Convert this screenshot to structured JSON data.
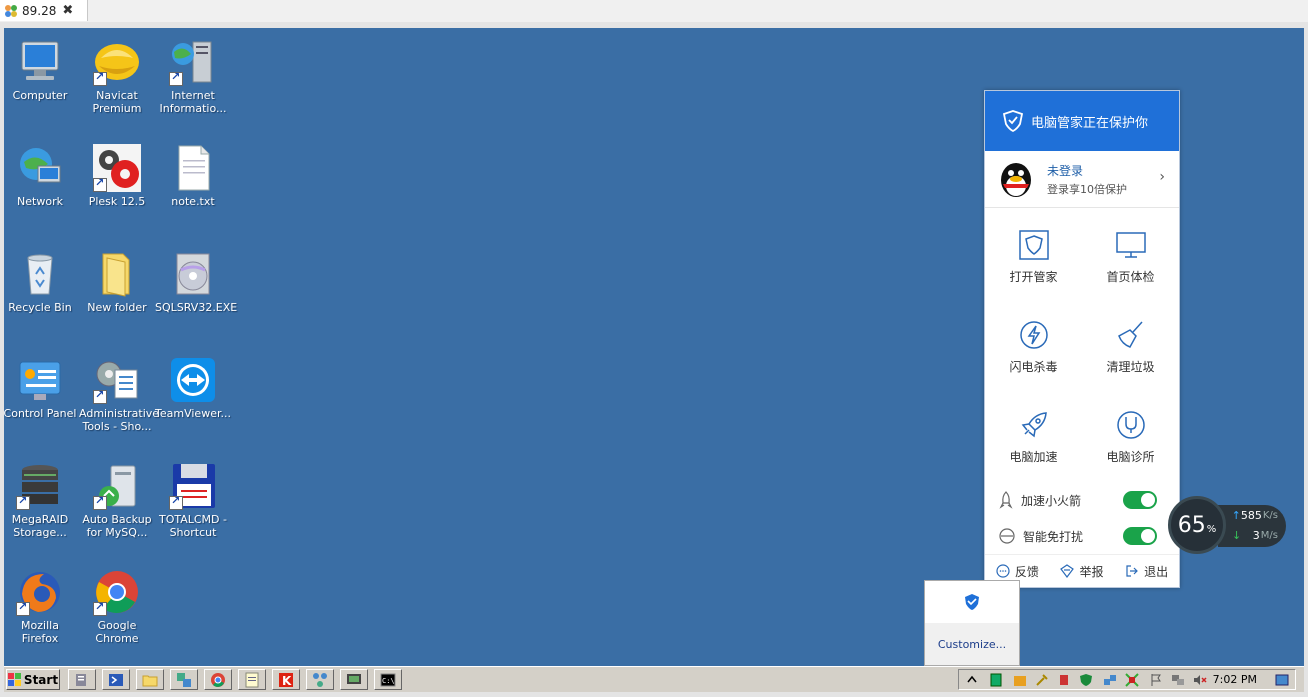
{
  "window": {
    "tab_title": "89.28"
  },
  "desktop_icons": [
    {
      "label": "Computer"
    },
    {
      "label": "Navicat Premium"
    },
    {
      "label": "Internet Informatio..."
    },
    {
      "label": "Network"
    },
    {
      "label": "Plesk 12.5"
    },
    {
      "label": "note.txt"
    },
    {
      "label": "Recycle Bin"
    },
    {
      "label": "New folder"
    },
    {
      "label": "SQLSRV32.EXE"
    },
    {
      "label": "Control Panel"
    },
    {
      "label": "Administrative Tools - Sho..."
    },
    {
      "label": "TeamViewer..."
    },
    {
      "label": "MegaRAID Storage..."
    },
    {
      "label": "Auto Backup for MySQ..."
    },
    {
      "label": "TOTALCMD - Shortcut"
    },
    {
      "label": "Mozilla Firefox"
    },
    {
      "label": "Google Chrome"
    }
  ],
  "security_panel": {
    "header": "电脑管家正在保护你",
    "user_name": "未登录",
    "user_sub": "登录享10倍保护",
    "grid": [
      {
        "label": "打开管家",
        "icon": "shield-icon"
      },
      {
        "label": "首页体检",
        "icon": "monitor-icon"
      },
      {
        "label": "闪电杀毒",
        "icon": "lightning-icon"
      },
      {
        "label": "清理垃圾",
        "icon": "broom-icon"
      },
      {
        "label": "电脑加速",
        "icon": "rocket-icon"
      },
      {
        "label": "电脑诊所",
        "icon": "stethoscope-icon"
      }
    ],
    "toggles": [
      {
        "label": "加速小火箭",
        "on": true
      },
      {
        "label": "智能免打扰",
        "on": true
      }
    ],
    "footer": [
      {
        "label": "反馈"
      },
      {
        "label": "举报"
      },
      {
        "label": "退出"
      }
    ]
  },
  "customize": {
    "label": "Customize..."
  },
  "speed_widget": {
    "percent": "65",
    "percent_sign": "%",
    "upload_value": "585",
    "upload_unit": "K/s",
    "download_value": "3",
    "download_unit": "M/s"
  },
  "taskbar": {
    "start_label": "Start",
    "clock": "7:02 PM"
  },
  "colors": {
    "desktop": "#3a6ea5",
    "panel_header": "#1f70d8",
    "toggle_on": "#1aa34a"
  }
}
